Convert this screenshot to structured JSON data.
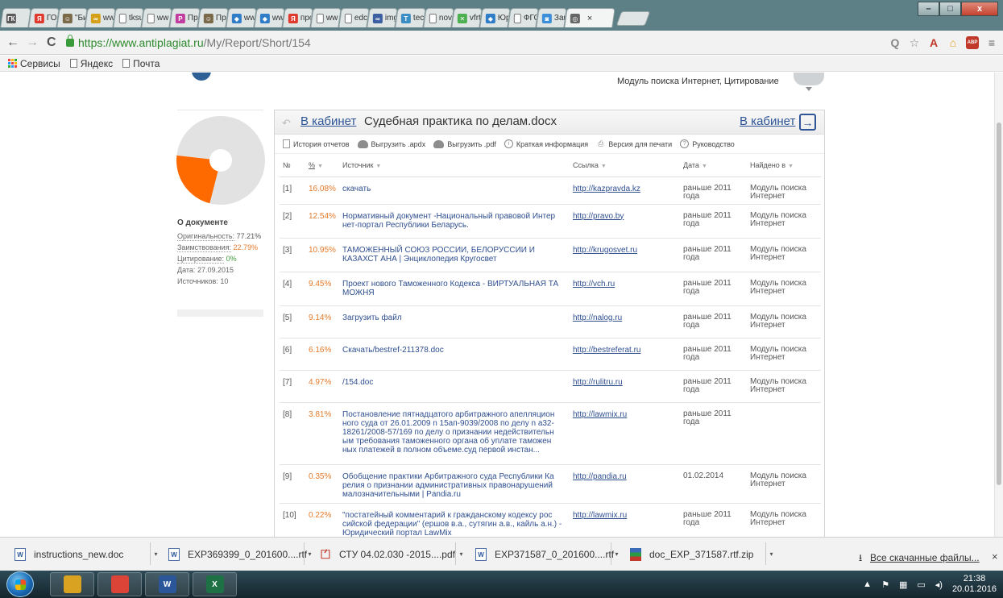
{
  "browser": {
    "tabs": [
      {
        "title": "",
        "icon": "ГК",
        "color": "#5a5a5a"
      },
      {
        "title": "ГОС",
        "icon": "Я",
        "color": "#e03a2f"
      },
      {
        "title": "\"Би",
        "icon": "☺",
        "color": "#7a6a4a"
      },
      {
        "title": "ww",
        "icon": "∞",
        "color": "#d4a017"
      },
      {
        "title": "tksu",
        "icon": "",
        "color": ""
      },
      {
        "title": "ww",
        "icon": "",
        "color": ""
      },
      {
        "title": "Прс",
        "icon": "P",
        "color": "#c23b9e"
      },
      {
        "title": "Пр",
        "icon": "☺",
        "color": "#7a6a4a"
      },
      {
        "title": "ww",
        "icon": "◆",
        "color": "#2f7cc7"
      },
      {
        "title": "ww",
        "icon": "◆",
        "color": "#2f7cc7"
      },
      {
        "title": "про",
        "icon": "Я",
        "color": "#e03a2f"
      },
      {
        "title": "ww",
        "icon": "",
        "color": ""
      },
      {
        "title": "edc",
        "icon": "",
        "color": ""
      },
      {
        "title": "img",
        "icon": "∞",
        "color": "#3b5fa0"
      },
      {
        "title": "tecl",
        "icon": "T",
        "color": "#3b8ec4"
      },
      {
        "title": "nov",
        "icon": "",
        "color": ""
      },
      {
        "title": "vfrt",
        "icon": "✕",
        "color": "#4caf50"
      },
      {
        "title": "Юр",
        "icon": "◆",
        "color": "#2f7cc7"
      },
      {
        "title": "ФГС",
        "icon": "",
        "color": ""
      },
      {
        "title": "Зак",
        "icon": "◙",
        "color": "#3a8fd8"
      },
      {
        "title": "",
        "icon": "◎",
        "color": "#666",
        "active": true
      }
    ],
    "tab_close": "×",
    "window": {
      "minimize": "–",
      "maximize": "□",
      "close": "x"
    },
    "nav": {
      "back": "←",
      "forward": "→",
      "reload": "C"
    },
    "url": {
      "secure": "https://www.antiplagiat.ru",
      "path": "/My/Report/Short/154"
    },
    "extensions": [
      {
        "name": "zoom-icon",
        "glyph": "Q",
        "color": "#888"
      },
      {
        "name": "star-icon",
        "glyph": "☆",
        "color": "#888"
      },
      {
        "name": "pdf-ext-icon",
        "glyph": "A",
        "color": "#c0392b"
      },
      {
        "name": "home-ext-icon",
        "glyph": "⌂",
        "color": "#e8a21c"
      },
      {
        "name": "adblock-icon",
        "glyph": "ABP",
        "color": "#c0392b"
      },
      {
        "name": "menu-icon",
        "glyph": "≡",
        "color": "#666"
      }
    ],
    "bookmarks": [
      {
        "label": "Сервисы",
        "type": "grid"
      },
      {
        "label": "Яндекс",
        "type": "page"
      },
      {
        "label": "Почта",
        "type": "page"
      }
    ]
  },
  "page": {
    "modules_label": "Модуль поиска Интернет, Цитирование",
    "pie": {
      "borrowed": 22.79,
      "original": 77.21,
      "borrowed_color": "#ff6a00",
      "original_color": "#e2e2e2"
    },
    "doc_info": {
      "heading": "О документе",
      "originality_label": "Оригинальность:",
      "originality_value": "77.21%",
      "borrowing_label": "Заимствования:",
      "borrowing_value": "22.79%",
      "citation_label": "Цитирование:",
      "citation_value": "0%",
      "date_label": "Дата:",
      "date_value": "27.09.2015",
      "sources_label": "Источников:",
      "sources_value": "10"
    },
    "report": {
      "cabinet_link": "В кабинет",
      "doc_name": "Судебная практика по делам.docx",
      "cabinet_link_right": "В кабинет",
      "actions": [
        {
          "label": "История отчетов",
          "icon": "doc"
        },
        {
          "label": "Выгрузить .apdx",
          "icon": "cloud"
        },
        {
          "label": "Выгрузить .pdf",
          "icon": "cloud"
        },
        {
          "label": "Краткая информация",
          "icon": "info"
        },
        {
          "label": "Версия для печати",
          "icon": "print"
        },
        {
          "label": "Руководство",
          "icon": "help"
        }
      ],
      "columns": {
        "num": "№",
        "pct": "%",
        "source": "Источник",
        "link": "Ссылка",
        "date": "Дата",
        "found": "Найдено в"
      },
      "rows": [
        {
          "num": "[1]",
          "pct": "16.08%",
          "source": "скачать",
          "link": "http://kazpravda.kz",
          "date": "раньше 2011 года",
          "found": "Модуль поиска Интернет",
          "h": 34
        },
        {
          "num": "[2]",
          "pct": "12.54%",
          "source": "Нормативный документ -Национальный правовой Интер нет-портал Республики Беларусь.",
          "link": "http://pravo.by",
          "date": "раньше 2011 года",
          "found": "Модуль поиска Интернет",
          "h": 42
        },
        {
          "num": "[3]",
          "pct": "10.95%",
          "source": "ТАМОЖЕННЫЙ СОЮЗ РОССИИ, БЕЛОРУССИИ И КАЗАХСТ АНА | Энциклопедия Кругосвет",
          "link": "http://krugosvet.ru",
          "date": "раньше 2011 года",
          "found": "Модуль поиска Интернет",
          "h": 42
        },
        {
          "num": "[4]",
          "pct": "9.45%",
          "source": "Проект нового Таможенного Кодекса - ВИРТУАЛЬНАЯ ТА МОЖНЯ",
          "link": "http://vch.ru",
          "date": "раньше 2011 года",
          "found": "Модуль поиска Интернет",
          "h": 42
        },
        {
          "num": "[5]",
          "pct": "9.14%",
          "source": "Загрузить файл",
          "link": "http://nalog.ru",
          "date": "раньше 2011 года",
          "found": "Модуль поиска Интернет",
          "h": 40
        },
        {
          "num": "[6]",
          "pct": "6.16%",
          "source": "Скачать/bestref-211378.doc",
          "link": "http://bestreferat.ru",
          "date": "раньше 2011 года",
          "found": "Модуль поиска Интернет",
          "h": 40
        },
        {
          "num": "[7]",
          "pct": "4.97%",
          "source": "/154.doc",
          "link": "http://rulitru.ru",
          "date": "раньше 2011 года",
          "found": "Модуль поиска Интернет",
          "h": 40
        },
        {
          "num": "[8]",
          "pct": "3.81%",
          "source": "Постановление пятнадцатого арбитражного апелляцион ного суда от 26.01.2009 n 15ап-9039/2008 по делу n а32-18261/2008-57/169 по делу о признании недействительн ым требования таможенного органа об уплате таможен ных платежей в полном объеме.суд первой инстан...",
          "link": "http://lawmix.ru",
          "date": "раньше 2011 года",
          "found": "",
          "h": 77
        },
        {
          "num": "[9]",
          "pct": "0.35%",
          "source": "Обобщение практики Арбитражного суда Республики Ка релия о признании административных правонарушений малозначительными | Pandia.ru",
          "link": "http://pandia.ru",
          "date": "01.02.2014",
          "found": "Модуль поиска Интернет",
          "h": 48
        },
        {
          "num": "[10]",
          "pct": "0.22%",
          "source": "\"постатейный комментарий к гражданскому кодексу рос сийской федерации\" (ершов в.а., сутягин а.в., кайль а.н.) - Юридический портал LawMix",
          "link": "http://lawmix.ru",
          "date": "раньше 2011 года",
          "found": "Модуль поиска Интернет",
          "h": 48
        }
      ]
    }
  },
  "downloads": {
    "items": [
      {
        "name": "instructions_new.doc",
        "type": "word"
      },
      {
        "name": "EXP369399_0_201600....rtf",
        "type": "word"
      },
      {
        "name": "СТУ 04.02.030 -2015....pdf",
        "type": "pdf"
      },
      {
        "name": "EXP371587_0_201600....rtf",
        "type": "word"
      },
      {
        "name": "doc_EXP_371587.rtf.zip",
        "type": "zip"
      }
    ],
    "show_all": "Все скачанные файлы...",
    "close": "×"
  },
  "taskbar": {
    "apps": [
      {
        "name": "explorer-icon",
        "color": "#d9a321",
        "glyph": ""
      },
      {
        "name": "chrome-icon",
        "color": "#db4437",
        "glyph": ""
      },
      {
        "name": "word-icon",
        "color": "#2b579a",
        "glyph": "W"
      },
      {
        "name": "excel-icon",
        "color": "#1e7145",
        "glyph": "X"
      }
    ],
    "time": "21:38",
    "date": "20.01.2016"
  }
}
